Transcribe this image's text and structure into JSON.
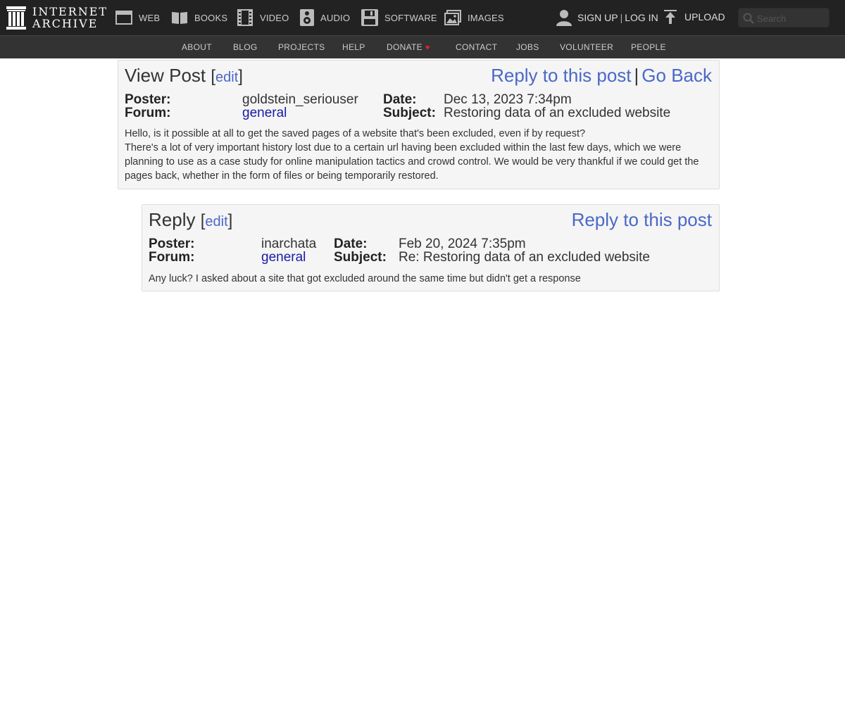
{
  "header": {
    "logo_line1": "INTERNET",
    "logo_line2": "ARCHIVE",
    "media": [
      {
        "label": "WEB",
        "icon": "web-icon"
      },
      {
        "label": "BOOKS",
        "icon": "books-icon"
      },
      {
        "label": "VIDEO",
        "icon": "video-icon"
      },
      {
        "label": "AUDIO",
        "icon": "audio-icon"
      },
      {
        "label": "SOFTWARE",
        "icon": "software-icon"
      },
      {
        "label": "IMAGES",
        "icon": "images-icon"
      }
    ],
    "signup": "SIGN UP",
    "separator": "|",
    "login": "LOG IN",
    "upload": "UPLOAD",
    "search_placeholder": "Search"
  },
  "subnav": [
    "ABOUT",
    "BLOG",
    "PROJECTS",
    "HELP",
    "DONATE",
    "CONTACT",
    "JOBS",
    "VOLUNTEER",
    "PEOPLE"
  ],
  "post": {
    "title": "View Post",
    "edit": "edit",
    "reply_link": "Reply to this post",
    "pipe": "|",
    "go_back": "Go Back",
    "poster_label": "Poster:",
    "poster": "goldstein_seriouser",
    "forum_label": "Forum:",
    "forum": "general",
    "date_label": "Date:",
    "date": "Dec 13, 2023 7:34pm",
    "subject_label": "Subject:",
    "subject": "Restoring data of an excluded website",
    "body_line1": "Hello, is it possible at all to get the saved pages of a website that's been excluded, even if by request?",
    "body_line2": "There's a lot of very important history lost due to a certain url having been excluded within the last few days, which we were planning to use as a case study for online manipulation tactics and crowd control. We would be very thankful if we could get the pages back, whether in the form of files or being temporarily restored."
  },
  "reply": {
    "title": "Reply",
    "edit": "edit",
    "reply_link": "Reply to this post",
    "poster_label": "Poster:",
    "poster": "inarchata",
    "forum_label": "Forum:",
    "forum": "general",
    "date_label": "Date:",
    "date": "Feb 20, 2024 7:35pm",
    "subject_label": "Subject:",
    "subject": "Re: Restoring data of an excluded website",
    "body": "Any luck? I asked about a site that got excluded around the same time but didn't get a response"
  },
  "colors": {
    "topbar": "#222222",
    "subnav": "#333333",
    "link": "#4a68c8",
    "forum_link": "#1a1aa6",
    "donate_heart": "#e52222"
  }
}
